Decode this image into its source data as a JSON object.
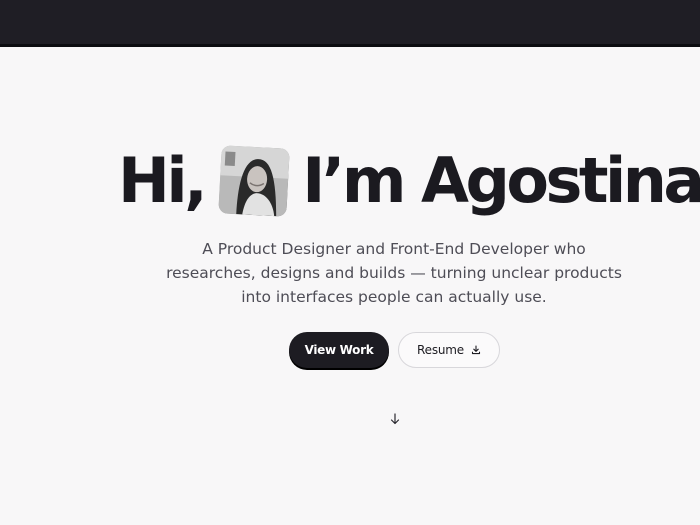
{
  "hero": {
    "greeting": "Hi,",
    "name": "I’m Agostina!",
    "avatar_icon": "portrait-photo"
  },
  "subtitle": {
    "line1": "A Product Designer and Front-End Developer who",
    "line2": "researches, designs and builds — turning unclear products",
    "line3": "into interfaces people can actually use."
  },
  "actions": {
    "view_work_label": "View Work",
    "resume_label": "Resume",
    "resume_icon": "download-icon"
  },
  "scroll": {
    "icon": "arrow-down-icon"
  },
  "colors": {
    "topbar": "#1f1e25",
    "background": "#f8f7f8",
    "primary_button": "#1d1c22",
    "text": "#1b1a20"
  }
}
